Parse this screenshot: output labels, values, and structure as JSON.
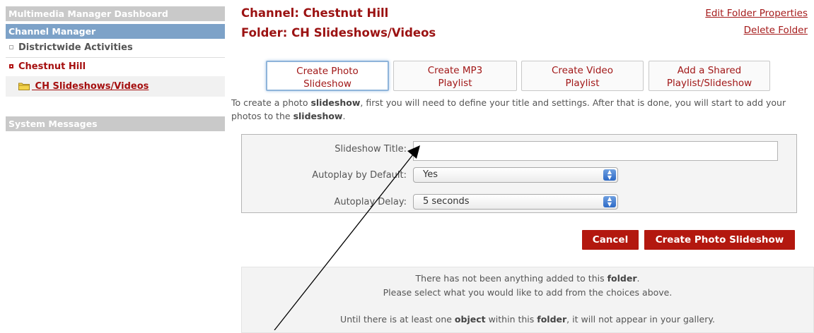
{
  "sidebar": {
    "dashboard_label": "Multimedia Manager Dashboard",
    "channel_manager_label": "Channel Manager",
    "items": [
      {
        "label": "Districtwide Activities"
      },
      {
        "label": "Chestnut Hill"
      }
    ],
    "sub_item_label": "CH Slideshows/Videos",
    "system_messages_label": "System Messages"
  },
  "header": {
    "channel": "Channel: Chestnut Hill",
    "folder": "Folder: CH Slideshows/Videos",
    "edit_link": "Edit Folder Properties",
    "delete_link": "Delete Folder"
  },
  "tabs": [
    {
      "line1": "Create Photo",
      "line2": "Slideshow"
    },
    {
      "line1": "Create MP3",
      "line2": "Playlist"
    },
    {
      "line1": "Create Video",
      "line2": "Playlist"
    },
    {
      "line1": "Add a Shared",
      "line2": "Playlist/Slideshow"
    }
  ],
  "description": {
    "part1": "To create a photo ",
    "bold1": "slideshow",
    "part2": ", first you will need to define your title and settings. After that is done, you will start to add your photos to the ",
    "bold2": "slideshow",
    "part3": "."
  },
  "form": {
    "title_label": "Slideshow Title:",
    "title_value": "",
    "autoplay_label": "Autoplay by Default:",
    "autoplay_value": "Yes",
    "delay_label": "Autoplay Delay:",
    "delay_value": "5 seconds"
  },
  "buttons": {
    "cancel": "Cancel",
    "create": "Create Photo Slideshow"
  },
  "info": {
    "line1_a": "There has not been anything added to this ",
    "line1_b": "folder",
    "line1_c": ".",
    "line2": "Please select what you would like to add from the choices above.",
    "line3_a": "Until there is at least one ",
    "line3_b": "object",
    "line3_c": " within this ",
    "line3_d": "folder",
    "line3_e": ", it will not appear in your gallery."
  },
  "colors": {
    "brand_red": "#b3180f",
    "link_red": "#a51b1b",
    "channel_blue": "#7da2c8"
  }
}
